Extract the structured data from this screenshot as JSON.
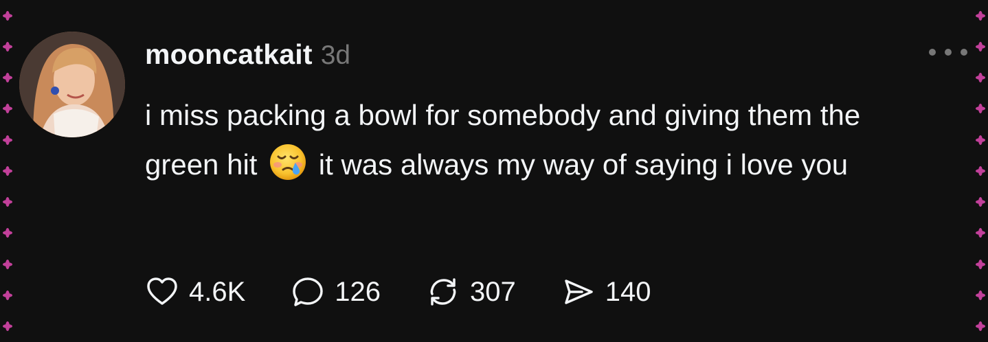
{
  "post": {
    "username": "mooncatkait",
    "time": "3d",
    "text_before_emoji": "i miss packing a bowl for somebody and giving them the green hit",
    "text_after_emoji": "it was always my way of saying i love you",
    "emoji_icon": "face-holding-back-tears-icon"
  },
  "actions": {
    "likes": "4.6K",
    "comments": "126",
    "reposts": "307",
    "shares": "140"
  },
  "colors": {
    "background": "#101010",
    "text_primary": "#f3f5f7",
    "text_secondary": "#777777",
    "border_flower": "#c2409a"
  }
}
